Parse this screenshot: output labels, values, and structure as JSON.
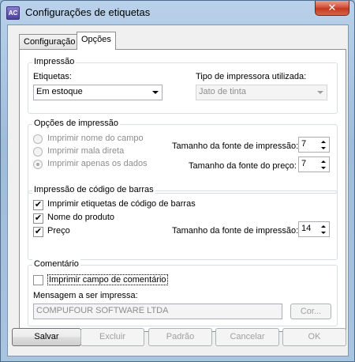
{
  "window": {
    "title": "Configurações de etiquetas",
    "app_icon_text": "AC",
    "close_glyph": "✕"
  },
  "tabs": [
    {
      "label": "Configuração",
      "active": false
    },
    {
      "label": "Opções",
      "active": true
    }
  ],
  "impressao": {
    "group_title": "Impressão",
    "etiquetas_label": "Etiquetas:",
    "etiquetas_value": "Em estoque",
    "tipo_label": "Tipo de impressora utilizada:",
    "tipo_value": "Jato de tinta"
  },
  "opcoes_impressao": {
    "group_title": "Opções de impressão",
    "radios": [
      {
        "label": "Imprimir nome do campo",
        "selected": false
      },
      {
        "label": "Imprimir mala direta",
        "selected": false
      },
      {
        "label": "Imprimir apenas os dados",
        "selected": true
      }
    ],
    "fonte_impressao_label": "Tamanho da fonte de impressão:",
    "fonte_impressao_value": "7",
    "fonte_preco_label": "Tamanho da fonte do preço:",
    "fonte_preco_value": "7"
  },
  "codigo_barras": {
    "group_title": "Impressão de código de barras",
    "checks": [
      {
        "label": "Imprimir etiquetas de código de barras",
        "checked": true
      },
      {
        "label": "Nome do produto",
        "checked": true
      },
      {
        "label": "Preço",
        "checked": true
      }
    ],
    "fonte_label": "Tamanho da fonte de impressão:",
    "fonte_value": "14"
  },
  "comentario": {
    "group_title": "Comentário",
    "check_label": "Imprimir campo de comentário",
    "checked": false,
    "mensagem_label": "Mensagem a ser impressa:",
    "mensagem_value": "COMPUFOUR SOFTWARE LTDA",
    "cor_button": "Cor..."
  },
  "buttons": {
    "salvar": "Salvar",
    "excluir": "Excluir",
    "padrao": "Padrão",
    "cancelar": "Cancelar",
    "ok": "OK"
  },
  "check_glyph": "✔"
}
